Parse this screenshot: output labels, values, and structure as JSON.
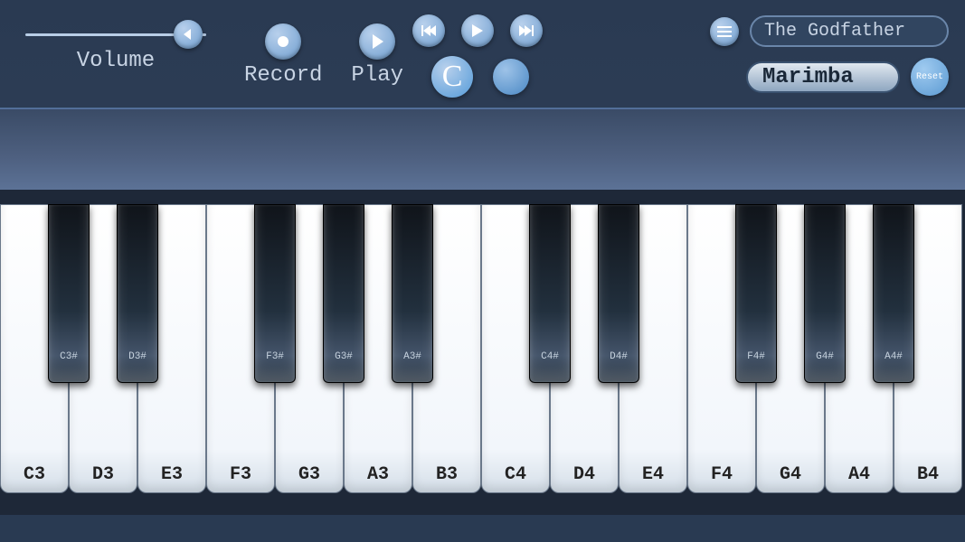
{
  "toolbar": {
    "volume_label": "Volume",
    "record_label": "Record",
    "play_label": "Play",
    "song_name": "The Godfather",
    "instrument_name": "Marimba",
    "reset_label": "Reset",
    "current_note": "C"
  },
  "white_keys": [
    {
      "label": "C3"
    },
    {
      "label": "D3"
    },
    {
      "label": "E3"
    },
    {
      "label": "F3"
    },
    {
      "label": "G3"
    },
    {
      "label": "A3"
    },
    {
      "label": "B3"
    },
    {
      "label": "C4"
    },
    {
      "label": "D4"
    },
    {
      "label": "E4"
    },
    {
      "label": "F4"
    },
    {
      "label": "G4"
    },
    {
      "label": "A4"
    },
    {
      "label": "B4"
    }
  ],
  "black_keys": [
    {
      "label": "C3#",
      "pos": 0
    },
    {
      "label": "D3#",
      "pos": 1
    },
    {
      "label": "F3#",
      "pos": 3
    },
    {
      "label": "G3#",
      "pos": 4
    },
    {
      "label": "A3#",
      "pos": 5
    },
    {
      "label": "C4#",
      "pos": 7
    },
    {
      "label": "D4#",
      "pos": 8
    },
    {
      "label": "F4#",
      "pos": 10
    },
    {
      "label": "G4#",
      "pos": 11
    },
    {
      "label": "A4#",
      "pos": 12
    }
  ]
}
